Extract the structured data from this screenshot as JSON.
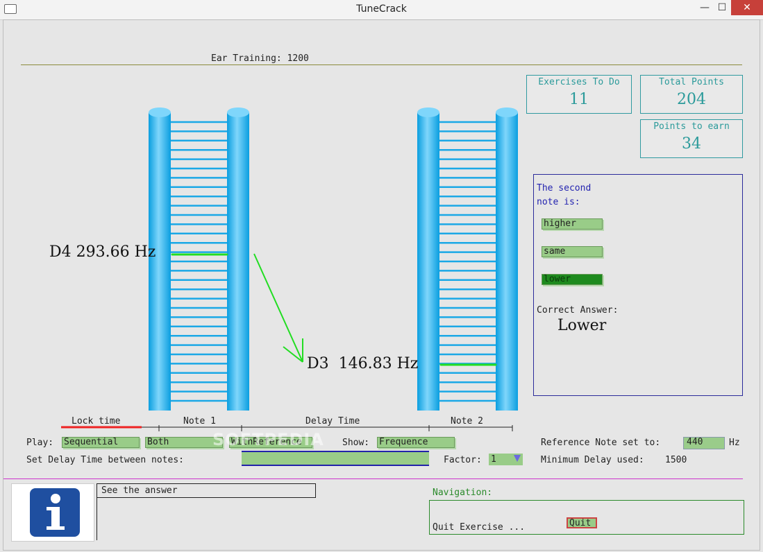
{
  "window": {
    "title": "TuneCrack",
    "min": "—",
    "max": "☐",
    "close": "✕"
  },
  "header": {
    "text": "Ear Training: 1200"
  },
  "stats": {
    "exercises_label": "Exercises To Do",
    "exercises_value": "11",
    "total_label": "Total Points",
    "total_value": "204",
    "earn_label": "Points to earn",
    "earn_value": "34"
  },
  "answer_panel": {
    "prompt": "The second\nnote is:",
    "higher": "higher",
    "same": "same",
    "lower": "lower",
    "correct_label": "Correct Answer:",
    "correct_value": "Lower"
  },
  "notes": {
    "note1": "D4 293.66 Hz",
    "note2": "D3  146.83 Hz"
  },
  "timeline": {
    "lock": "Lock time",
    "note1": "Note 1",
    "delay": "Delay Time",
    "note2": "Note 2"
  },
  "controls": {
    "play_label": "Play:",
    "play_sequential": "Sequential",
    "play_both": "Both",
    "play_withref": "WithReference",
    "show_label": "Show:",
    "show_value": "Frequence",
    "ref_label": "Reference Note set to:",
    "ref_value": "440",
    "ref_unit": "Hz",
    "delay_label": "Set Delay Time between notes:",
    "factor_label": "Factor:",
    "factor_value": "1",
    "min_delay_label": "Minimum Delay used:",
    "min_delay_value": "1500",
    "watermark": "SOFTPEDIA"
  },
  "footer": {
    "info_text": "See the answer",
    "nav_label": "Navigation:",
    "quit_text": "Quit Exercise ...",
    "quit_button": "Quit"
  },
  "colors": {
    "accent": "#2a9a9a",
    "button_green": "#99cc88",
    "ladder_blue": "#1aa8e6",
    "highlight": "#22dd22"
  }
}
